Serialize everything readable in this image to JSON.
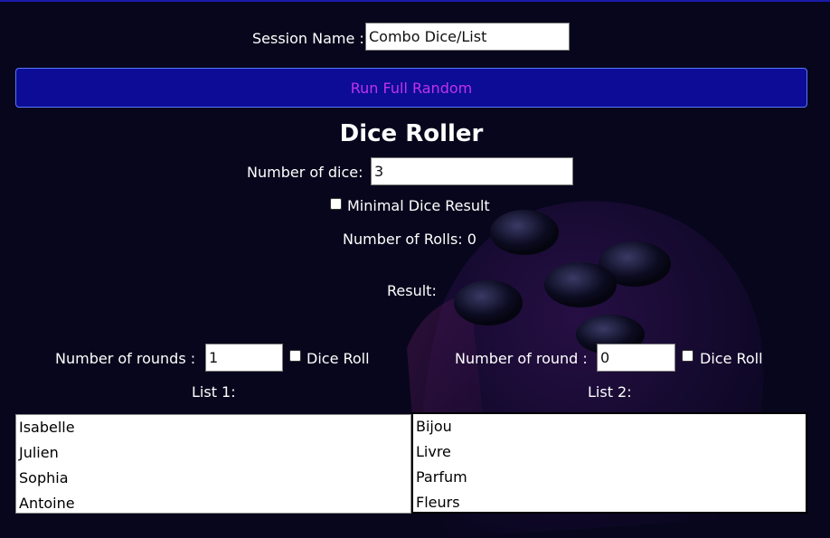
{
  "session": {
    "label": "Session Name :",
    "value": "Combo Dice/List"
  },
  "run_button": "Run Full Random",
  "dice_roller": {
    "title": "Dice Roller",
    "number_of_dice_label": "Number of dice:",
    "number_of_dice_value": "3",
    "minimal_label": "Minimal Dice Result",
    "minimal_checked": false,
    "rolls_text": "Number of Rolls: 0",
    "result_label": "Result:"
  },
  "list1": {
    "rounds_label": "Number of rounds :",
    "rounds_value": "1",
    "dice_roll_label": "Dice Roll",
    "dice_roll_checked": false,
    "title": "List 1:",
    "items": [
      "Isabelle",
      "Julien",
      "Sophia",
      "Antoine"
    ]
  },
  "list2": {
    "rounds_label": "Number of round :",
    "rounds_value": "0",
    "dice_roll_label": "Dice Roll",
    "dice_roll_checked": false,
    "title": "List 2:",
    "items": [
      "Bijou",
      "Livre",
      "Parfum",
      "Fleurs"
    ]
  },
  "colors": {
    "background": "#07061c",
    "button_bg": "#0c0c96",
    "button_text": "#c032ee",
    "button_border": "#5a78ff"
  },
  "background_image": "die-graphic"
}
